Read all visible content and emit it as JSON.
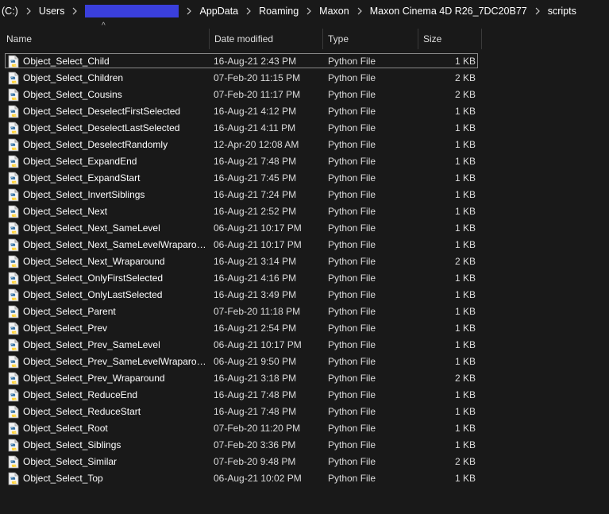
{
  "breadcrumb": {
    "items": [
      "(C:)",
      "Users",
      "",
      "AppData",
      "Roaming",
      "Maxon",
      "Maxon Cinema 4D R26_7DC20B77",
      "scripts"
    ]
  },
  "columns": {
    "name": "Name",
    "date": "Date modified",
    "type": "Type",
    "size": "Size"
  },
  "sort_indicator": "^",
  "files": [
    {
      "name": "Object_Select_Child",
      "date": "16-Aug-21 2:43 PM",
      "type": "Python File",
      "size": "1 KB"
    },
    {
      "name": "Object_Select_Children",
      "date": "07-Feb-20 11:15 PM",
      "type": "Python File",
      "size": "2 KB"
    },
    {
      "name": "Object_Select_Cousins",
      "date": "07-Feb-20 11:17 PM",
      "type": "Python File",
      "size": "2 KB"
    },
    {
      "name": "Object_Select_DeselectFirstSelected",
      "date": "16-Aug-21 4:12 PM",
      "type": "Python File",
      "size": "1 KB"
    },
    {
      "name": "Object_Select_DeselectLastSelected",
      "date": "16-Aug-21 4:11 PM",
      "type": "Python File",
      "size": "1 KB"
    },
    {
      "name": "Object_Select_DeselectRandomly",
      "date": "12-Apr-20 12:08 AM",
      "type": "Python File",
      "size": "1 KB"
    },
    {
      "name": "Object_Select_ExpandEnd",
      "date": "16-Aug-21 7:48 PM",
      "type": "Python File",
      "size": "1 KB"
    },
    {
      "name": "Object_Select_ExpandStart",
      "date": "16-Aug-21 7:45 PM",
      "type": "Python File",
      "size": "1 KB"
    },
    {
      "name": "Object_Select_InvertSiblings",
      "date": "16-Aug-21 7:24 PM",
      "type": "Python File",
      "size": "1 KB"
    },
    {
      "name": "Object_Select_Next",
      "date": "16-Aug-21 2:52 PM",
      "type": "Python File",
      "size": "1 KB"
    },
    {
      "name": "Object_Select_Next_SameLevel",
      "date": "06-Aug-21 10:17 PM",
      "type": "Python File",
      "size": "1 KB"
    },
    {
      "name": "Object_Select_Next_SameLevelWraparou...",
      "date": "06-Aug-21 10:17 PM",
      "type": "Python File",
      "size": "1 KB"
    },
    {
      "name": "Object_Select_Next_Wraparound",
      "date": "16-Aug-21 3:14 PM",
      "type": "Python File",
      "size": "2 KB"
    },
    {
      "name": "Object_Select_OnlyFirstSelected",
      "date": "16-Aug-21 4:16 PM",
      "type": "Python File",
      "size": "1 KB"
    },
    {
      "name": "Object_Select_OnlyLastSelected",
      "date": "16-Aug-21 3:49 PM",
      "type": "Python File",
      "size": "1 KB"
    },
    {
      "name": "Object_Select_Parent",
      "date": "07-Feb-20 11:18 PM",
      "type": "Python File",
      "size": "1 KB"
    },
    {
      "name": "Object_Select_Prev",
      "date": "16-Aug-21 2:54 PM",
      "type": "Python File",
      "size": "1 KB"
    },
    {
      "name": "Object_Select_Prev_SameLevel",
      "date": "06-Aug-21 10:17 PM",
      "type": "Python File",
      "size": "1 KB"
    },
    {
      "name": "Object_Select_Prev_SameLevelWraparound",
      "date": "06-Aug-21 9:50 PM",
      "type": "Python File",
      "size": "1 KB"
    },
    {
      "name": "Object_Select_Prev_Wraparound",
      "date": "16-Aug-21 3:18 PM",
      "type": "Python File",
      "size": "2 KB"
    },
    {
      "name": "Object_Select_ReduceEnd",
      "date": "16-Aug-21 7:48 PM",
      "type": "Python File",
      "size": "1 KB"
    },
    {
      "name": "Object_Select_ReduceStart",
      "date": "16-Aug-21 7:48 PM",
      "type": "Python File",
      "size": "1 KB"
    },
    {
      "name": "Object_Select_Root",
      "date": "07-Feb-20 11:20 PM",
      "type": "Python File",
      "size": "1 KB"
    },
    {
      "name": "Object_Select_Siblings",
      "date": "07-Feb-20 3:36 PM",
      "type": "Python File",
      "size": "1 KB"
    },
    {
      "name": "Object_Select_Similar",
      "date": "07-Feb-20 9:48 PM",
      "type": "Python File",
      "size": "2 KB"
    },
    {
      "name": "Object_Select_Top",
      "date": "06-Aug-21 10:02 PM",
      "type": "Python File",
      "size": "1 KB"
    }
  ],
  "focused_index": 0,
  "file_icon": "python-file-icon",
  "colors": {
    "background": "#191919",
    "redaction": "#3a3fdc",
    "text": "#ffffff",
    "focus_border": "#8a8a8a"
  }
}
